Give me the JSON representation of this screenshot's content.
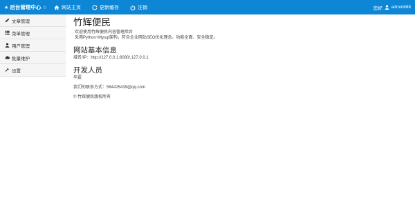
{
  "header": {
    "brand": "后台管理中心",
    "nav": [
      {
        "label": "网站主页",
        "icon": "home-icon"
      },
      {
        "label": "更新缓存",
        "icon": "refresh-icon"
      },
      {
        "label": "注销",
        "icon": "power-icon"
      }
    ],
    "greeting": "您好:",
    "username": "admin888",
    "colors": {
      "bar": "#0d86d6",
      "text": "#ffffff"
    }
  },
  "sidebar": {
    "items": [
      {
        "label": "文章管理",
        "icon": "pencil-icon"
      },
      {
        "label": "菜单管理",
        "icon": "list-icon"
      },
      {
        "label": "用户管理",
        "icon": "user-icon"
      },
      {
        "label": "批量维护",
        "icon": "cloud-icon"
      },
      {
        "label": "设置",
        "icon": "wrench-icon"
      }
    ]
  },
  "main": {
    "title": "竹辉便民",
    "intro": [
      "欢迎使用竹辉便民内容管理后台",
      "采用Python+Mysql架构，符合企业网站SEO优化理念、功能全面、安全稳定。"
    ],
    "info_title": "网站基本信息",
    "domain_line": "域名/IP：http://127.0.0.1:8080/,127.0.0.1",
    "dev_title": "开发人员",
    "dev_name": "华霆",
    "contact_line": "我们的联系方式：584425439@qq.com",
    "copyright": "© 竹辉便民版权所有"
  }
}
